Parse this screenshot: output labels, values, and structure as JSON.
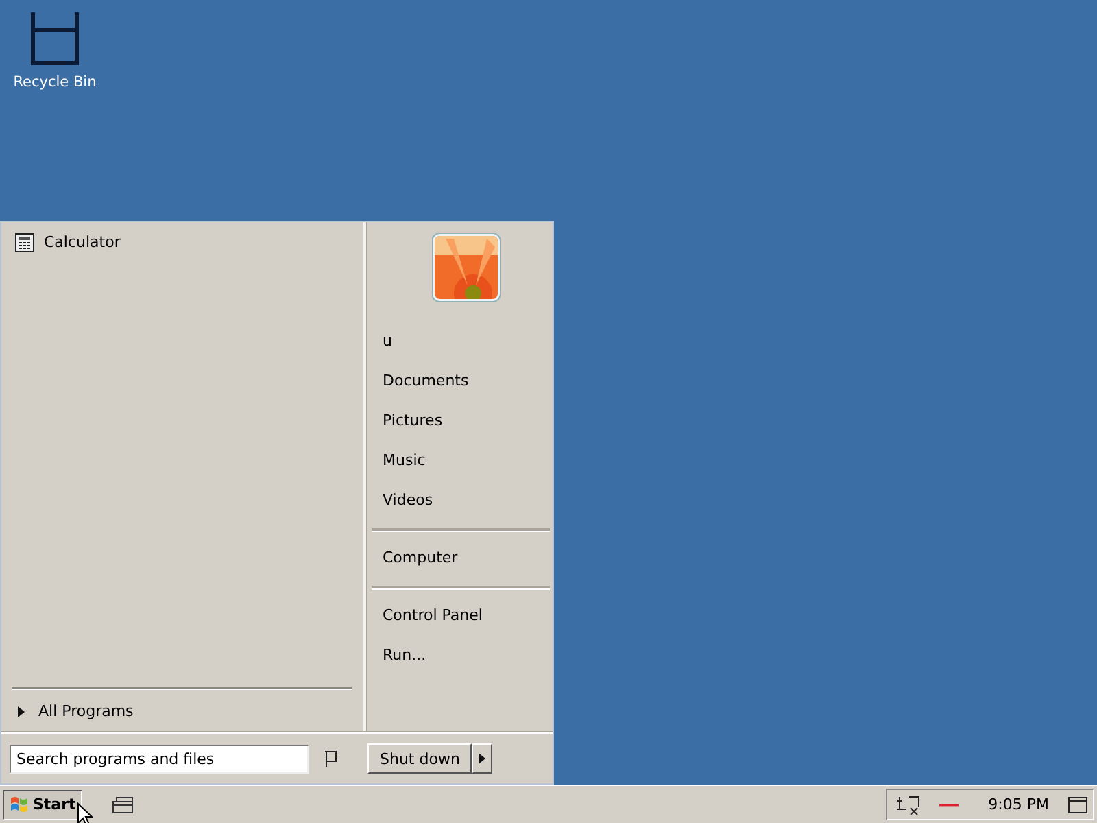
{
  "desktop_icons": [
    {
      "label": "Recycle Bin"
    }
  ],
  "start_menu": {
    "programs": [
      {
        "label": "Calculator"
      }
    ],
    "all_programs": "All Programs",
    "search": {
      "placeholder": "Search programs and files"
    },
    "place_groups": [
      {
        "items": [
          "u",
          "Documents",
          "Pictures",
          "Music",
          "Videos"
        ]
      },
      {
        "items": [
          "Computer"
        ]
      },
      {
        "items": [
          "Control Panel",
          "Run..."
        ]
      }
    ],
    "shut_down": "Shut down"
  },
  "taskbar": {
    "start": "Start",
    "clock": "9:05 PM"
  }
}
